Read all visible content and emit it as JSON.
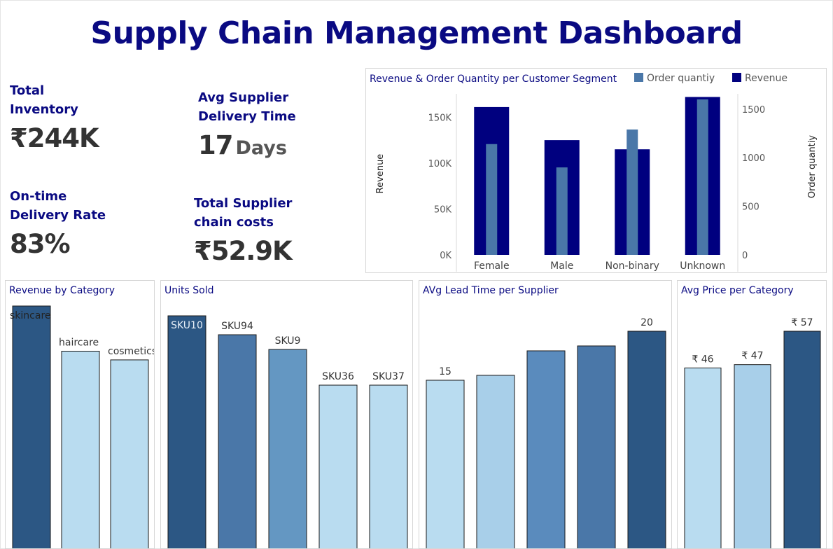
{
  "title": "Supply Chain Management Dashboard",
  "kpis": [
    {
      "label": "Total\nInventory",
      "value": "₹244K",
      "unit": ""
    },
    {
      "label": "Avg Supplier\nDelivery Time",
      "value": "17",
      "unit": "Days"
    },
    {
      "label": "On-time\nDelivery Rate",
      "value": "83%",
      "unit": ""
    },
    {
      "label": "Total Supplier\nchain costs",
      "value": "₹52.9K",
      "unit": ""
    }
  ],
  "chart_data": [
    {
      "type": "bar",
      "title": "Revenue & Order Quantity per Customer Segment",
      "categories": [
        "Female",
        "Male",
        "Non-binary",
        "Unknown"
      ],
      "series": [
        {
          "name": "Revenue",
          "axis": "left",
          "color": "#00007f",
          "values": [
            161000,
            125000,
            115000,
            172000
          ]
        },
        {
          "name": "Order quantiy",
          "axis": "right",
          "color": "#4a77a8",
          "values": [
            1140,
            900,
            1290,
            1600
          ]
        }
      ],
      "ylabel": "Revenue",
      "y2label": "Order quantiy",
      "ylim": [
        0,
        180000
      ],
      "y2lim": [
        0,
        1700
      ],
      "yticks": [
        "0K",
        "50K",
        "100K",
        "150K"
      ],
      "yticks_values": [
        0,
        50000,
        100000,
        150000
      ],
      "y2ticks": [
        "0",
        "500",
        "1000",
        "1500"
      ],
      "y2ticks_values": [
        0,
        500,
        1000,
        1500
      ],
      "legend": "top-right"
    },
    {
      "type": "bar",
      "title": "Revenue by Category",
      "categories": [
        "skincare",
        "haircare",
        "cosmetics"
      ],
      "values": [
        241628,
        174455,
        161521
      ],
      "colors": [
        "#2c5784",
        "#b9dcf0",
        "#b9dcf0"
      ]
    },
    {
      "type": "bar",
      "title": "Units Sold",
      "categories": [
        "SKU10",
        "SKU94",
        "SKU9",
        "SKU36",
        "SKU37"
      ],
      "values": [
        996,
        987,
        980,
        963,
        963
      ],
      "colors": [
        "#2c5784",
        "#4a77a8",
        "#6497c2",
        "#b9dcf0",
        "#b9dcf0"
      ]
    },
    {
      "type": "bar",
      "title": "AVg Lead Time per Supplier",
      "categories": [
        "",
        "",
        "",
        "",
        ""
      ],
      "values": [
        15,
        15.5,
        18,
        18.5,
        20
      ],
      "data_labels": [
        "15",
        "",
        "",
        "",
        "20"
      ],
      "colors": [
        "#b9dcf0",
        "#a8cfe9",
        "#5a8bbd",
        "#4a77a8",
        "#2c5784"
      ]
    },
    {
      "type": "bar",
      "title": "Avg Price per Category",
      "categories": [
        "",
        "",
        ""
      ],
      "values": [
        46,
        47,
        57
      ],
      "data_labels": [
        "₹ 46",
        "₹ 47",
        "₹ 57"
      ],
      "colors": [
        "#b9dcf0",
        "#a8cfe9",
        "#2c5784"
      ]
    }
  ]
}
